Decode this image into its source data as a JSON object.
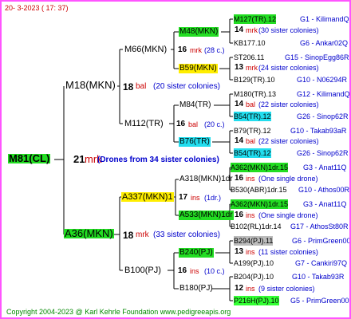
{
  "header": {
    "date": "20-  3-2023 (  17:  37)"
  },
  "footer": {
    "copyright": "Copyright 2004-2023 @ Karl Kehrle Foundation    www.pedigreeapis.org"
  },
  "root": {
    "id": "M81(CL)",
    "count": "21",
    "unit": "mrk",
    "note": "(Drones from 34 sister colonies)"
  },
  "gen1": {
    "father": {
      "id": "M18(MKN)",
      "count": "18",
      "unit": "bal",
      "note": "(20 sister colonies)"
    },
    "mother": {
      "id": "A36(MKN)",
      "count": "18",
      "unit": "mrk",
      "note": "(33 sister colonies)"
    }
  },
  "gen2": {
    "m66": {
      "id": "M66(MKN)",
      "count": "16",
      "unit": "mrk",
      "note": "(28 c.)"
    },
    "m112": {
      "id": "M112(TR)",
      "count": "16",
      "unit": "bal",
      "note": "(20 c.)"
    },
    "a337": {
      "id": "A337(MKN)1",
      "count": "17",
      "unit": "ins",
      "note": "(1dr.)"
    },
    "b100": {
      "id": "B100(PJ)",
      "count": "16",
      "unit": "ins",
      "note": "(10 c.)"
    }
  },
  "gen3": {
    "m48": {
      "id": "M48(MKN)",
      "count": "14",
      "unit": "mrk",
      "note": "(30 sister colonies)"
    },
    "b59": {
      "id": "B59(MKN)",
      "count": "13",
      "unit": "mrk",
      "note": "(24 sister colonies)"
    },
    "m84": {
      "id": "M84(TR)",
      "count": "14",
      "unit": "bal",
      "note": "(22 sister colonies)"
    },
    "b76": {
      "id": "B76(TR)",
      "count": "14",
      "unit": "bal",
      "note": "(22 sister colonies)"
    },
    "a318": {
      "id": "A318(MKN)1dr",
      "count": "16",
      "unit": "ins",
      "note": "(One single drone)"
    },
    "a533": {
      "id": "A533(MKN)1dr",
      "count": "16",
      "unit": "ins",
      "note": "(One single drone)"
    },
    "b240": {
      "id": "B240(PJ)",
      "count": "13",
      "unit": "ins",
      "note": "(11 sister colonies)"
    },
    "b180": {
      "id": "B180(PJ)",
      "count": "12",
      "unit": "ins",
      "note": "(9 sister colonies)"
    }
  },
  "gen4": [
    {
      "id": "M127(TR).12",
      "fam": "G1 - KilimandQ"
    },
    {
      "id": "KB177.10",
      "fam": "G6 - Ankar02Q"
    },
    {
      "id": "ST206.11",
      "fam": "G15 - SinopEgg86R"
    },
    {
      "id": "B129(TR).10",
      "fam": "G10 - N06294R"
    },
    {
      "id": "M180(TR).13",
      "fam": "G12 - KilimandQ"
    },
    {
      "id": "B54(TR).12",
      "fam": "G26 - Sinop62R"
    },
    {
      "id": "B79(TR).12",
      "fam": "G10 - Takab93aR"
    },
    {
      "id": "B54(TR).12",
      "fam": "G26 - Sinop62R"
    },
    {
      "id": "A362(MKN)1dr.15",
      "fam": "G3 - Anat11Q"
    },
    {
      "id": "B530(ABR)1dr.15",
      "fam": "G10 - Athos00R"
    },
    {
      "id": "A362(MKN)1dr.15",
      "fam": "G3 - Anat11Q"
    },
    {
      "id": "B102(RL)1dr.14",
      "fam": "G17 - AthosSt80R"
    },
    {
      "id": "B294(PJ).11",
      "fam": "G6 - PrimGreen00"
    },
    {
      "id": "A199(PJ).10",
      "fam": "G7 - Cankiri97Q"
    },
    {
      "id": "B204(PJ).10",
      "fam": "G10 - Takab93R"
    },
    {
      "id": "P216H(PJ).10",
      "fam": "G5 - PrimGreen00"
    }
  ]
}
